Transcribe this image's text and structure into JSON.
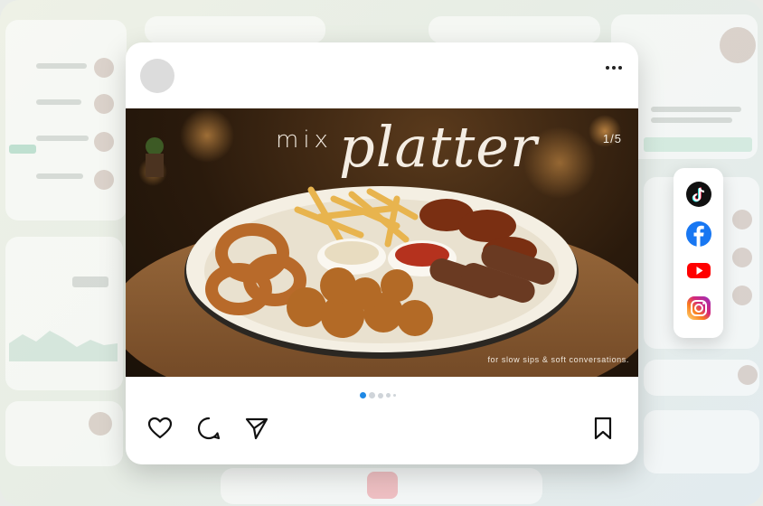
{
  "post": {
    "headline_word_1": "mix",
    "headline_word_2": "platter",
    "image_counter": "1/5",
    "tagline": "for slow sips & soft conversations.",
    "carousel": {
      "total_dots": 5,
      "active_index": 0
    }
  },
  "icons": {
    "more": "more-dots-icon",
    "like": "heart-icon",
    "comment": "comment-icon",
    "share": "send-icon",
    "save": "bookmark-icon"
  },
  "share_targets": [
    {
      "name": "tiktok-icon"
    },
    {
      "name": "facebook-icon"
    },
    {
      "name": "youtube-icon"
    },
    {
      "name": "instagram-icon"
    }
  ],
  "colors": {
    "active_dot": "#1e88e5",
    "inactive_dot": "#cfd4d9",
    "facebook": "#1877f2",
    "youtube": "#ff0000"
  }
}
